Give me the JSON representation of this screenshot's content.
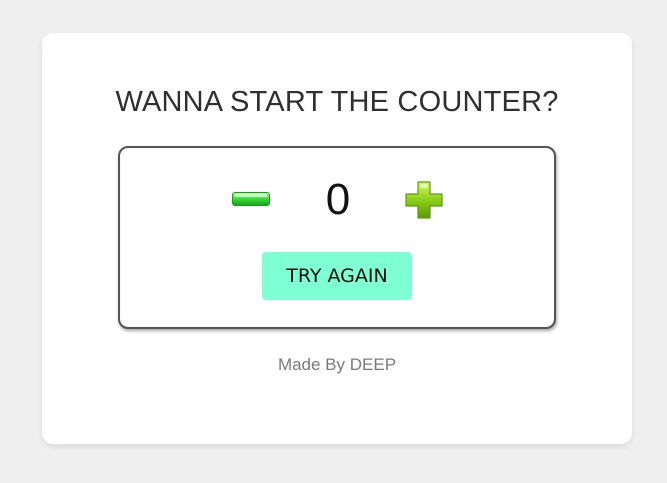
{
  "title": "WANNA START THE COUNTER?",
  "counter": {
    "value": "0",
    "decrement_icon": "minus-icon",
    "increment_icon": "plus-icon"
  },
  "buttons": {
    "reset_label": "TRY AGAIN"
  },
  "footer": {
    "credit": "Made By DEEP"
  },
  "colors": {
    "page_background": "#efefef",
    "card_background": "#ffffff",
    "reset_button": "#7fffd4",
    "icon_green": "#3fd83f",
    "plus_green": "#8ccf18"
  }
}
